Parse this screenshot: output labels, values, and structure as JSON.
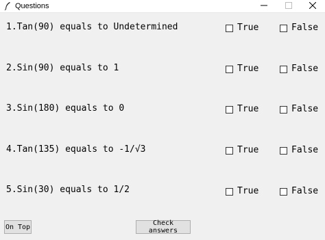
{
  "window": {
    "title": "Questions"
  },
  "questions": [
    {
      "text": "1.Tan(90) equals to Undetermined",
      "true_label": "True",
      "false_label": "False"
    },
    {
      "text": "2.Sin(90) equals to 1",
      "true_label": "True",
      "false_label": "False"
    },
    {
      "text": "3.Sin(180) equals to 0",
      "true_label": "True",
      "false_label": "False"
    },
    {
      "text": "4.Tan(135) equals to -1/√3",
      "true_label": "True",
      "false_label": "False"
    },
    {
      "text": "5.Sin(30) equals to 1/2",
      "true_label": "True",
      "false_label": "False"
    }
  ],
  "buttons": {
    "on_top": "On Top",
    "check": "Check answers"
  },
  "icons": {
    "app": "feather-icon",
    "minimize": "minimize-icon",
    "maximize": "maximize-icon",
    "close": "close-icon"
  }
}
